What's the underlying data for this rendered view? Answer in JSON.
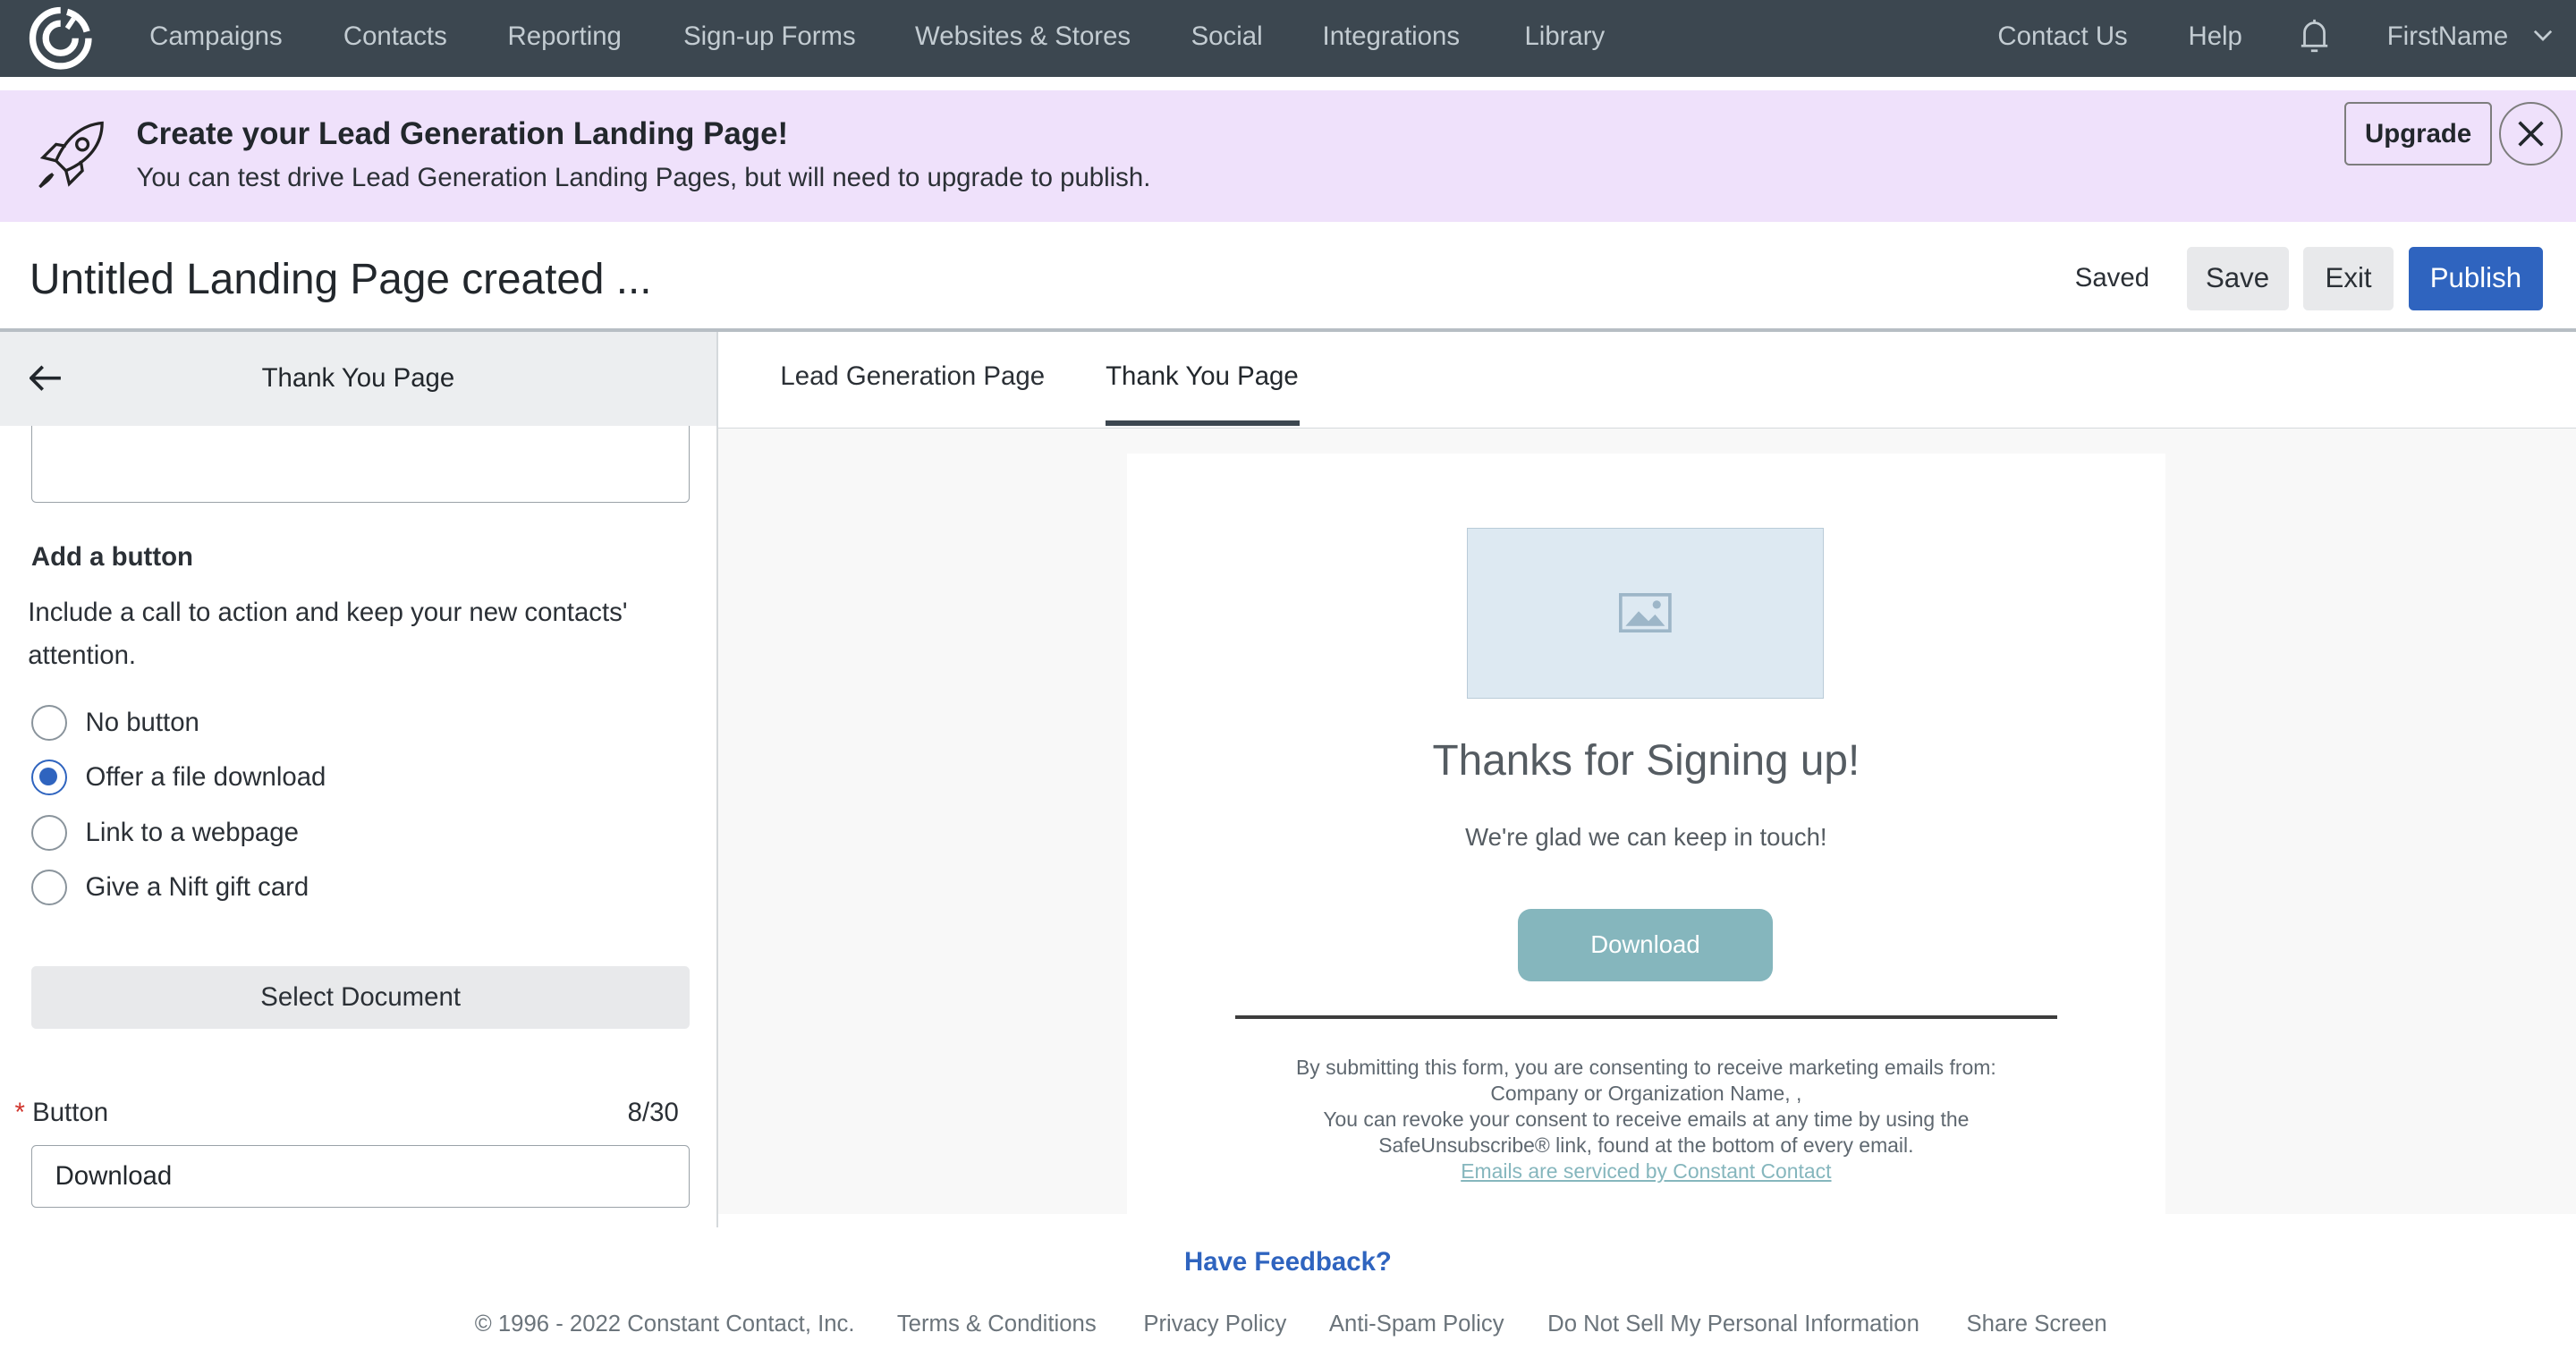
{
  "nav": {
    "items": [
      "Campaigns",
      "Contacts",
      "Reporting",
      "Sign-up Forms",
      "Websites & Stores",
      "Social",
      "Integrations",
      "Library"
    ],
    "right": [
      "Contact Us",
      "Help"
    ],
    "user": "FirstName"
  },
  "banner": {
    "title": "Create your Lead Generation Landing Page!",
    "text": "You can test drive Lead Generation Landing Pages, but will need to upgrade to publish.",
    "upgrade": "Upgrade",
    "bg": "#efe1fb"
  },
  "header": {
    "title": "Untitled Landing Page created ...",
    "status": "Saved",
    "save": "Save",
    "exit": "Exit",
    "publish": "Publish",
    "accent": "#2f64bf"
  },
  "panel": {
    "title": "Thank You Page",
    "section_title": "Add a button",
    "section_desc": "Include a call to action and keep your new contacts' attention.",
    "options": [
      {
        "label": "No button",
        "selected": false
      },
      {
        "label": "Offer a file download",
        "selected": true
      },
      {
        "label": "Link to a webpage",
        "selected": false
      },
      {
        "label": "Give a Nift gift card",
        "selected": false
      }
    ],
    "select_document": "Select Document",
    "button_label": "Button",
    "button_count": "8/30",
    "button_value": "Download"
  },
  "tabs": [
    {
      "label": "Lead Generation Page",
      "active": false
    },
    {
      "label": "Thank You Page",
      "active": true
    }
  ],
  "preview": {
    "heading": "Thanks for Signing up!",
    "subheading": "We're glad we can keep in touch!",
    "button": "Download",
    "button_color": "#85b6bd",
    "legal": [
      "By submitting this form, you are consenting to receive marketing emails from:",
      "Company or Organization Name, ,",
      "You can revoke your consent to receive emails at any time by using the",
      "SafeUnsubscribe® link, found at the bottom of every email."
    ],
    "legal_link": "Emails are serviced by Constant Contact"
  },
  "footer": {
    "feedback": "Have Feedback?",
    "copyright": "© 1996 - 2022 Constant Contact, Inc.",
    "links": [
      "Terms & Conditions",
      "Privacy Policy",
      "Anti-Spam Policy",
      "Do Not Sell My Personal Information",
      "Share Screen"
    ]
  }
}
